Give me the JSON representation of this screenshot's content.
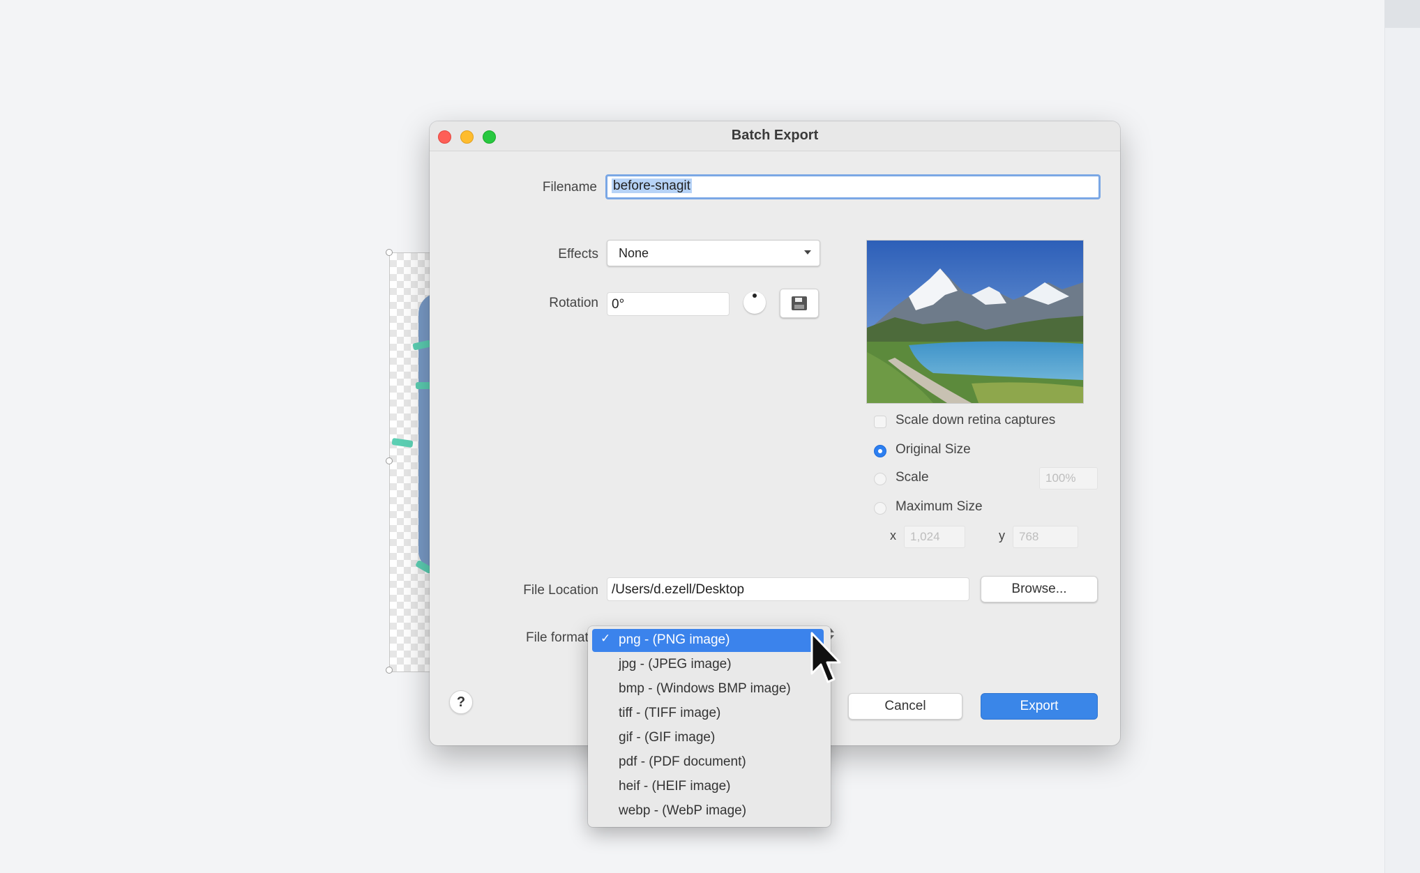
{
  "window": {
    "title": "Batch Export"
  },
  "form": {
    "filename_label": "Filename",
    "filename_value": "before-snagit",
    "effects_label": "Effects",
    "effects_value": "None",
    "rotation_label": "Rotation",
    "rotation_value": "0°",
    "location_label": "File Location",
    "location_value": "/Users/d.ezell/Desktop",
    "browse_label": "Browse...",
    "format_label": "File format"
  },
  "size_options": {
    "scale_retina_label": "Scale down retina captures",
    "original_label": "Original Size",
    "scale_label": "Scale",
    "scale_value": "100%",
    "max_label": "Maximum Size",
    "x_label": "x",
    "x_value": "1,024",
    "y_label": "y",
    "y_value": "768"
  },
  "format_menu": {
    "items": [
      "png - (PNG image)",
      "jpg - (JPEG image)",
      "bmp - (Windows BMP image)",
      "tiff - (TIFF image)",
      "gif - (GIF image)",
      "pdf - (PDF document)",
      "heif - (HEIF image)",
      "webp - (WebP image)"
    ],
    "selected_index": 0,
    "check": "✓"
  },
  "buttons": {
    "help": "?",
    "cancel": "Cancel",
    "export": "Export"
  },
  "colors": {
    "accent": "#3b83ec",
    "close": "#fe5f57",
    "minimize": "#febc2e",
    "maximize": "#28c840"
  }
}
